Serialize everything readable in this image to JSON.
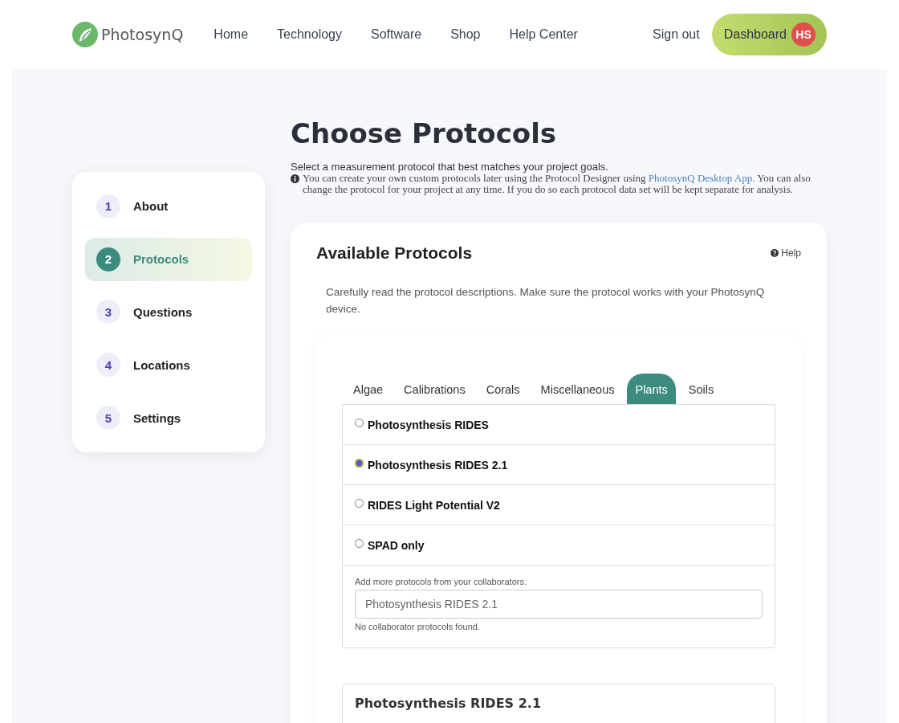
{
  "header": {
    "logo_text": "PhotosynQ",
    "nav": [
      "Home",
      "Technology",
      "Software",
      "Shop",
      "Help Center"
    ],
    "sign_out": "Sign out",
    "dashboard": "Dashboard",
    "avatar_initials": "HS"
  },
  "steps": [
    {
      "number": "1",
      "label": "About",
      "selected": false
    },
    {
      "number": "2",
      "label": "Protocols",
      "selected": true
    },
    {
      "number": "3",
      "label": "Questions",
      "selected": false
    },
    {
      "number": "4",
      "label": "Locations",
      "selected": false
    },
    {
      "number": "5",
      "label": "Settings",
      "selected": false
    }
  ],
  "page": {
    "title": "Choose Protocols",
    "subtitle": "Select a measurement protocol that best matches your project goals.",
    "note_before": "You can create your own custom protocols later using the Protocol Designer using",
    "note_link": "PhotosynQ Desktop App.",
    "note_after": "You can also change the protocol for your project at any time. If you do so each protocol data set will be kept separate for analysis."
  },
  "card": {
    "title": "Available Protocols",
    "help": "Help",
    "description": "Carefully read the protocol descriptions. Make sure the protocol works with your PhotosynQ device.",
    "tabs": [
      {
        "label": "Algae",
        "selected": false
      },
      {
        "label": "Calibrations",
        "selected": false
      },
      {
        "label": "Corals",
        "selected": false
      },
      {
        "label": "Miscellaneous",
        "selected": false
      },
      {
        "label": "Plants",
        "selected": true
      },
      {
        "label": "Soils",
        "selected": false
      }
    ],
    "protocols": [
      {
        "name": "Photosynthesis RIDES",
        "selected": false
      },
      {
        "name": "Photosynthesis RIDES 2.1",
        "selected": true
      },
      {
        "name": "RIDES Light Potential V2",
        "selected": false
      },
      {
        "name": "SPAD only",
        "selected": false
      }
    ],
    "collab_label": "Add more protocols from your collaborators.",
    "collab_placeholder": "Photosynthesis RIDES 2.1",
    "collab_hint": "No collaborator protocols found.",
    "detail_title": "Photosynthesis RIDES 2.1"
  }
}
